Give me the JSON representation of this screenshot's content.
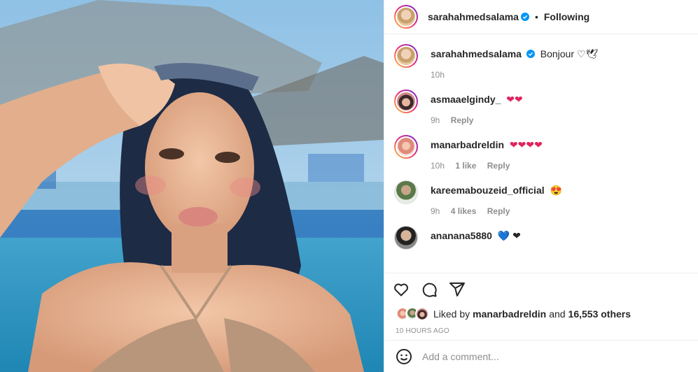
{
  "post": {
    "author": "sarahahmedsalama",
    "follow_status": "Following",
    "dot": "•"
  },
  "photo": {
    "description_icon": "selfie-photo"
  },
  "comments": [
    {
      "user": "sarahahmedsalama",
      "text": "Bonjour ♡🕊",
      "time": "10h",
      "verified": true
    },
    {
      "user": "asmaaelgindy_",
      "text": "❤❤",
      "time": "9h",
      "reply": "Reply"
    },
    {
      "user": "manarbadreldin",
      "text": "❤❤❤❤",
      "time": "10h",
      "likes": "1 like",
      "reply": "Reply"
    },
    {
      "user": "kareemabouzeid_official",
      "text": "😍",
      "time": "9h",
      "likes": "4 likes",
      "reply": "Reply"
    },
    {
      "user": "ananana5880",
      "text": "💙 ❤",
      "time": ""
    }
  ],
  "likes": {
    "prefix": "Liked by",
    "user": "manarbadreldin",
    "joiner": "and",
    "others": "16,553 others"
  },
  "timestamp": "10 HOURS AGO",
  "add_comment": {
    "placeholder": "Add a comment..."
  },
  "colors": {
    "accent": "#0095f6",
    "heart": "#e0245e"
  }
}
